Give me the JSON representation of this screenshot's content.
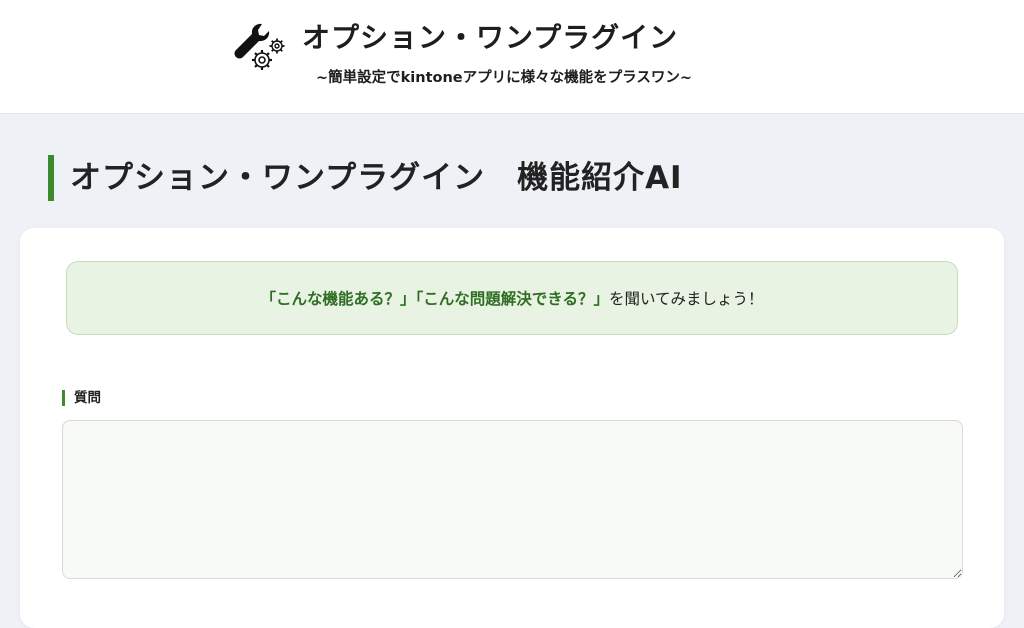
{
  "header": {
    "logo_icon": "wrench-gears-icon",
    "title": "オプション・ワンプラグイン",
    "subtitle": "~簡単設定でkintoneアプリに様々な機能をプラスワン~"
  },
  "page": {
    "title": "オプション・ワンプラグイン　機能紹介AI"
  },
  "notice": {
    "highlight": "「こんな機能ある？」「こんな問題解決できる？」",
    "text": "を聞いてみましょう！"
  },
  "question": {
    "label": "質問",
    "value": "",
    "placeholder": ""
  },
  "colors": {
    "accent": "#3d8a2e",
    "notice_bg": "#e8f3e3",
    "highlight_text": "#2f6e23",
    "page_bg": "#eef1f5"
  }
}
